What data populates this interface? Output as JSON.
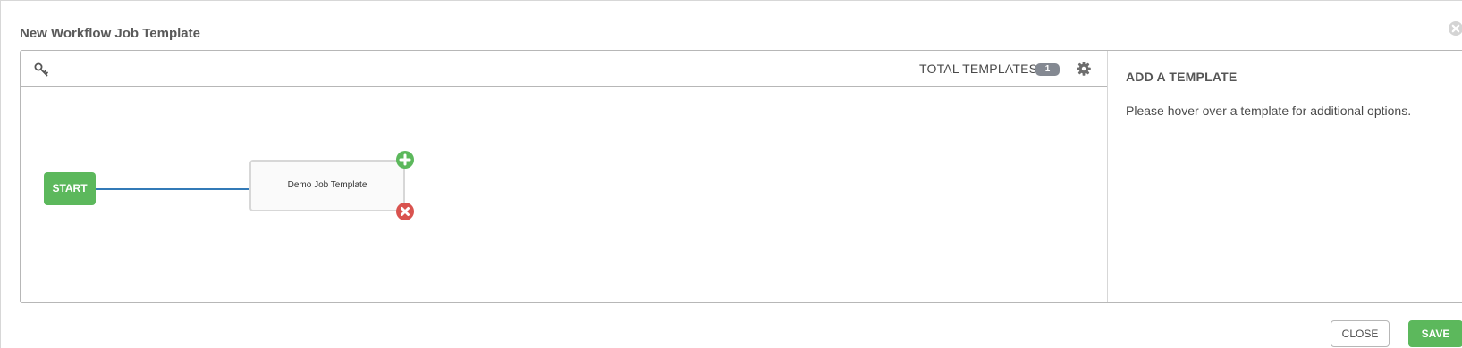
{
  "modal": {
    "title": "New Workflow Job Template"
  },
  "toolbar": {
    "total_label": "TOTAL TEMPLATES",
    "total_count": "1",
    "key_icon": "key-icon",
    "settings_icon": "gear-icon"
  },
  "graph": {
    "start_label": "START",
    "nodes": [
      {
        "label": "Demo Job Template"
      }
    ],
    "add_icon": "plus-icon",
    "remove_icon": "x-icon"
  },
  "side_panel": {
    "title": "ADD A TEMPLATE",
    "message": "Please hover over a template for additional options."
  },
  "footer": {
    "close_label": "CLOSE",
    "save_label": "SAVE"
  },
  "colors": {
    "success": "#5cb85c",
    "danger": "#d9534f",
    "link": "#337ab7",
    "badge": "#848992"
  }
}
